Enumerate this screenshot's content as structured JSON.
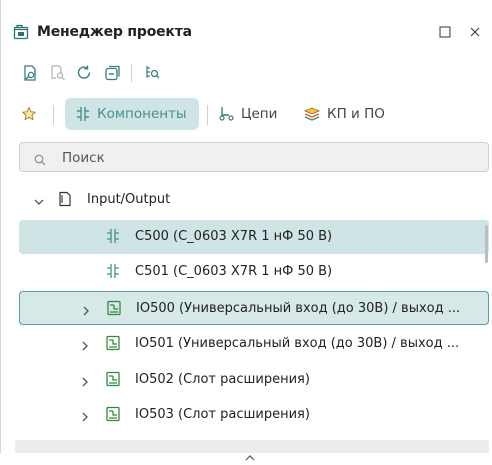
{
  "window": {
    "title": "Менеджер проекта"
  },
  "toolbar": {
    "icons": [
      "document-icon",
      "find-icon",
      "refresh-icon",
      "collapse-icon",
      "search-zoom-icon"
    ]
  },
  "tabs": [
    {
      "label": "",
      "icon": "star-icon",
      "active": false
    },
    {
      "label": "Компоненты",
      "icon": "component-icon",
      "active": true
    },
    {
      "label": "Цепи",
      "icon": "net-icon",
      "active": false
    },
    {
      "label": "КП и ПО",
      "icon": "layers-icon",
      "active": false
    }
  ],
  "search": {
    "placeholder": "Поиск",
    "value": ""
  },
  "tree": {
    "rows": [
      {
        "label": "Input/Output",
        "icon": "file-icon",
        "expanded": true
      },
      {
        "label": "C500 (C_0603 X7R 1 нФ 50 В)",
        "icon": "capacitor-icon",
        "state": "selected"
      },
      {
        "label": "C501 (C_0603 X7R 1 нФ 50 В)",
        "icon": "capacitor-icon",
        "state": "normal"
      },
      {
        "label": "IO500 (Универсальный вход (до 30В) / выход ...",
        "icon": "module-icon",
        "state": "focused"
      },
      {
        "label": "IO501 (Универсальный вход (до 30В) / выход ...",
        "icon": "module-icon",
        "state": "normal"
      },
      {
        "label": "IO502 (Слот расширения)",
        "icon": "module-icon",
        "state": "normal"
      },
      {
        "label": "IO503 (Слот расширения)",
        "icon": "module-icon",
        "state": "normal"
      }
    ]
  },
  "colors": {
    "accent": "#4a8f8f",
    "selection": "#cfe4e4",
    "module_green": "#2e8b3a"
  }
}
